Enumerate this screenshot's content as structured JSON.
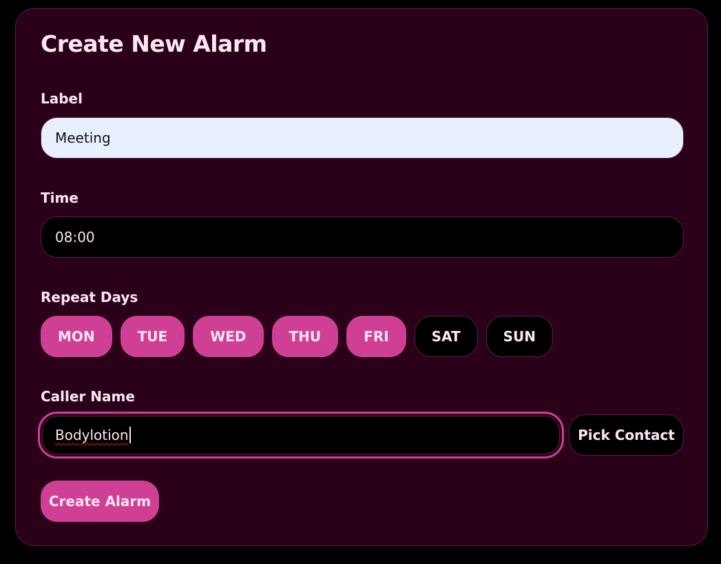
{
  "form": {
    "title": "Create New Alarm",
    "label_field": {
      "label": "Label",
      "value": "Meeting"
    },
    "time_field": {
      "label": "Time",
      "value": "08:00"
    },
    "repeat": {
      "label": "Repeat Days",
      "days": [
        {
          "label": "MON",
          "selected": true
        },
        {
          "label": "TUE",
          "selected": true
        },
        {
          "label": "WED",
          "selected": true
        },
        {
          "label": "THU",
          "selected": true
        },
        {
          "label": "FRI",
          "selected": true
        },
        {
          "label": "SAT",
          "selected": false
        },
        {
          "label": "SUN",
          "selected": false
        }
      ]
    },
    "caller_field": {
      "label": "Caller Name",
      "value": "Bodylotion"
    },
    "pick_contact_label": "Pick Contact",
    "create_label": "Create Alarm"
  },
  "colors": {
    "page_background": "#000000",
    "card_background": "#2b0019",
    "accent": "#cf3f94",
    "text": "#fde6f2"
  }
}
